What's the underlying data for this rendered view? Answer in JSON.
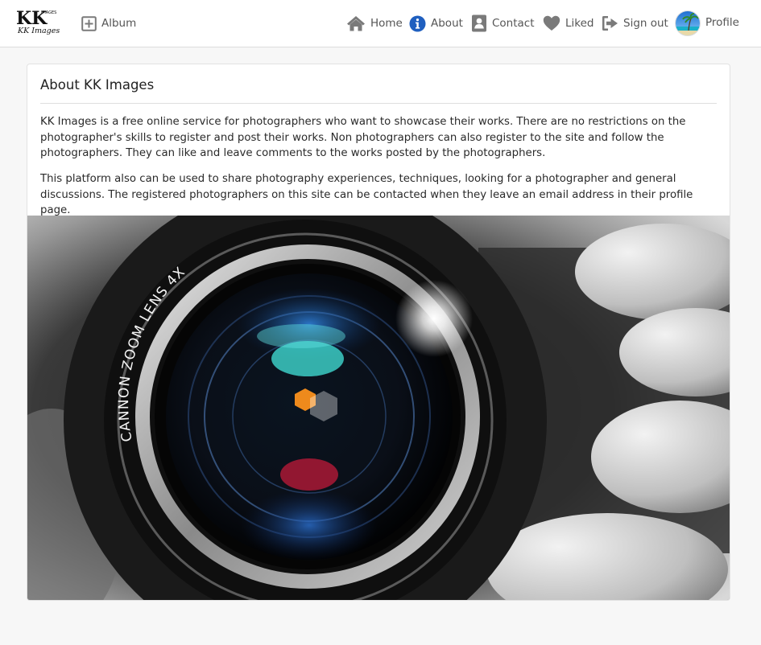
{
  "brand": {
    "logo_mark": "KK",
    "logo_small": "IMAGES",
    "logo_text": "KK Images"
  },
  "nav": {
    "album": {
      "label": "Album",
      "icon": "plus-square-icon"
    },
    "home": {
      "label": "Home",
      "icon": "home-icon"
    },
    "about": {
      "label": "About",
      "icon": "info-circle-icon"
    },
    "contact": {
      "label": "Contact",
      "icon": "contact-card-icon"
    },
    "liked": {
      "label": "Liked",
      "icon": "heart-icon"
    },
    "signout": {
      "label": "Sign out",
      "icon": "sign-out-icon"
    },
    "profile": {
      "label": "Profile",
      "icon": "avatar-beach-image"
    }
  },
  "colors": {
    "about_icon": "#1f5fbf",
    "nav_icon": "#7a7a7a",
    "nav_text": "#555555"
  },
  "about": {
    "title": "About KK Images",
    "paragraphs": [
      "KK Images is a free online service for photographers who want to showcase their works. There are no restrictions on the photographer's skills to register and post their works. Non photographers can also register to the site and follow the photographers. They can like and leave comments to the works posted by the photographers.",
      "This platform also can be used to share photography experiences, techniques, looking for a photographer and general discussions. The registered photographers on this site can be contacted when they leave an email address in their profile page."
    ],
    "image": {
      "description_icon": "camera-lens-photo",
      "lens_text": "CANNON ZOOM LENS 4X"
    }
  }
}
